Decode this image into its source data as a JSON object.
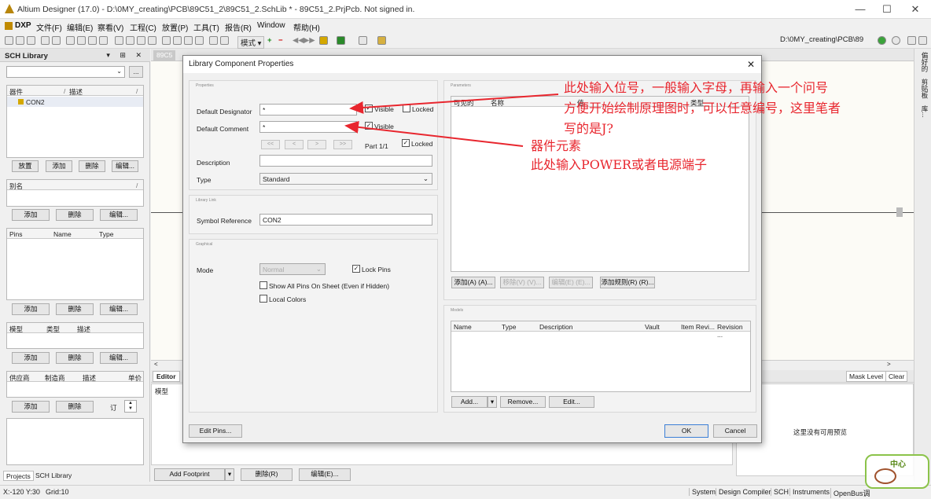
{
  "window": {
    "title": "Altium Designer (17.0) - D:\\0MY_creating\\PCB\\89C51_2\\89C51_2.SchLib * - 89C51_2.PrjPcb. Not signed in.",
    "controls": {
      "minimize": "—",
      "maximize": "☐",
      "close": "✕"
    }
  },
  "menu": {
    "dxp": "DXP",
    "items": [
      "文件(F)",
      "编辑(E)",
      "察看(V)",
      "工程(C)",
      "放置(P)",
      "工具(T)",
      "报告(R)",
      "Window",
      "帮助(H)"
    ]
  },
  "toolbar": {
    "mode_label": "模式",
    "path": "D:\\0MY_creating\\PCB\\89"
  },
  "sch_library": {
    "title": "SCH Library",
    "components_header": [
      "器件",
      "描述"
    ],
    "components": [
      "CON2"
    ],
    "component_buttons": [
      "放置",
      "添加",
      "删除",
      "编辑..."
    ],
    "alias_header": "别名",
    "alias_buttons": [
      "添加",
      "删除",
      "编辑..."
    ],
    "pins_header": [
      "Pins",
      "Name",
      "Type"
    ],
    "pins_buttons": [
      "添加",
      "删除",
      "编辑..."
    ],
    "model_header": [
      "模型",
      "类型",
      "描述"
    ],
    "model_buttons": [
      "添加",
      "删除",
      "编辑..."
    ],
    "supplier_header": [
      "供应商",
      "制造商",
      "描述",
      "单价"
    ],
    "supplier_buttons": [
      "添加",
      "删除"
    ],
    "order_label": "订",
    "bottom_tabs": [
      "Projects",
      "SCH Library"
    ]
  },
  "document_tab": "89C5",
  "editor": {
    "tab": "Editor",
    "model_label": "模型",
    "mask_level": "Mask Level",
    "clear": "Clear",
    "no_preview": "这里没有可用预览",
    "add_footprint": "Add Footprint",
    "delete": "删除(R)",
    "edit": "编辑(E)..."
  },
  "right_strip": [
    "偏好的",
    "剪贴板",
    "库..."
  ],
  "status": {
    "coords": "X:-120 Y:30",
    "grid": "Grid:10",
    "panels": [
      "System",
      "Design Compiler",
      "SCH",
      "Instruments",
      "OpenBus调"
    ]
  },
  "dialog": {
    "title": "Library Component Properties",
    "close": "✕",
    "properties_caption": "Properties",
    "default_designator_label": "Default Designator",
    "default_designator_value": "*",
    "visible_label": "Visible",
    "locked_label": "Locked",
    "default_comment_label": "Default Comment",
    "default_comment_value": "*",
    "nav": [
      "<<",
      "<",
      ">",
      ">>"
    ],
    "part_label": "Part 1/1",
    "description_label": "Description",
    "description_value": "",
    "type_label": "Type",
    "type_value": "Standard",
    "library_link_caption": "Library Link",
    "symbol_reference_label": "Symbol Reference",
    "symbol_reference_value": "CON2",
    "graphical_caption": "Graphical",
    "mode_label": "Mode",
    "mode_value": "Normal",
    "lock_pins_label": "Lock Pins",
    "show_all_pins_label": "Show All Pins On Sheet (Even if Hidden)",
    "local_colors_label": "Local Colors",
    "parameters_caption": "Parameters",
    "param_columns": [
      "可见的",
      "名称",
      "值",
      "类型"
    ],
    "param_buttons": [
      "添加(A) (A)...",
      "移除(V) (V)...",
      "编辑(E) (E)...",
      "添加规则(R) (R)..."
    ],
    "models_caption": "Models",
    "model_columns": [
      "Name",
      "Type",
      "Description",
      "Vault",
      "Item Revi...",
      "Revision ..."
    ],
    "model_buttons": [
      "Add...",
      "Remove...",
      "Edit..."
    ],
    "edit_pins": "Edit Pins...",
    "ok": "OK",
    "cancel": "Cancel"
  },
  "annotations": {
    "line1": "此处输入位号，一般输入字母，再输入一个问号",
    "line2": "方便开始绘制原理图时，可以任意编号，这里笔者",
    "line3": "写的是J?",
    "line4": "器件元素",
    "line5": "此处输入POWER或者电源端子",
    "color": "#e8262e"
  },
  "watermark": "中心"
}
